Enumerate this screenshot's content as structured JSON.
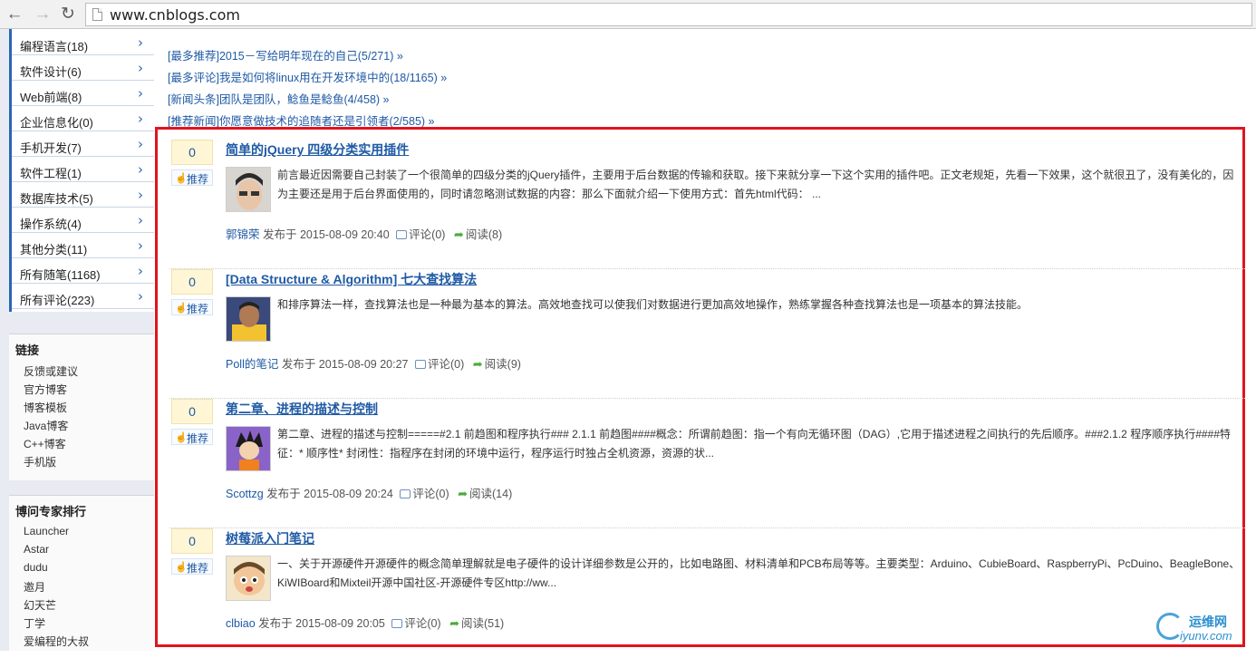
{
  "browser": {
    "url": "www.cnblogs.com"
  },
  "sidebar": {
    "categories": [
      {
        "label": "编程语言(18)"
      },
      {
        "label": "软件设计(6)"
      },
      {
        "label": "Web前端(8)"
      },
      {
        "label": "企业信息化(0)"
      },
      {
        "label": "手机开发(7)"
      },
      {
        "label": "软件工程(1)"
      },
      {
        "label": "数据库技术(5)"
      },
      {
        "label": "操作系统(4)"
      },
      {
        "label": "其他分类(11)"
      },
      {
        "label": "所有随笔(1168)"
      },
      {
        "label": "所有评论(223)"
      }
    ],
    "links": {
      "title": "链接",
      "items": [
        "反馈或建议",
        "官方博客",
        "博客模板",
        "Java博客",
        "C++博客",
        "手机版"
      ]
    },
    "experts": {
      "title": "博问专家排行",
      "items": [
        "Launcher",
        "Astar",
        "dudu",
        "邀月",
        "幻天芒",
        "丁学",
        "爱编程的大叔"
      ]
    }
  },
  "recommend": [
    "[最多推荐]2015－写给明年现在的自己(5/271) »",
    "[最多评论]我是如何将linux用在开发环境中的(18/1165) »",
    "[新闻头条]团队是团队，鲶鱼是鲶鱼(4/458) »",
    "[推荐新闻]你愿意做技术的追随者还是引领者(2/585) »"
  ],
  "posts": [
    {
      "digg": "0",
      "digg_label": "推荐",
      "title": "简单的jQuery 四级分类实用插件",
      "summary": "前言最近因需要自己封装了一个很简单的四级分类的jQuery插件，主要用于后台数据的传输和获取。接下来就分享一下这个实用的插件吧。正文老规矩，先看一下效果，这个就很丑了，没有美化的，因为主要还是用于后台界面使用的，同时请忽略测试数据的内容：那么下面就介绍一下使用方式：首先html代码： ...",
      "author": "郭锦荣",
      "published": "发布于 2015-08-09 20:40",
      "comments": "评论(0)",
      "views": "阅读(8)"
    },
    {
      "digg": "0",
      "digg_label": "推荐",
      "title": "[Data Structure & Algorithm] 七大查找算法",
      "summary": "和排序算法一样，查找算法也是一种最为基本的算法。高效地查找可以使我们对数据进行更加高效地操作，熟练掌握各种查找算法也是一项基本的算法技能。",
      "author": "Poll的笔记",
      "published": "发布于 2015-08-09 20:27",
      "comments": "评论(0)",
      "views": "阅读(9)"
    },
    {
      "digg": "0",
      "digg_label": "推荐",
      "title": "第二章、进程的描述与控制",
      "summary": "第二章、进程的描述与控制=====#2.1 前趋图和程序执行### 2.1.1 前趋图####概念：所谓前趋图：指一个有向无循环图（DAG）,它用于描述进程之间执行的先后顺序。###2.1.2 程序顺序执行####特征：* 顺序性* 封闭性：指程序在封闭的环境中运行，程序运行时独占全机资源，资源的状...",
      "author": "Scottzg",
      "published": "发布于 2015-08-09 20:24",
      "comments": "评论(0)",
      "views": "阅读(14)"
    },
    {
      "digg": "0",
      "digg_label": "推荐",
      "title": "树莓派入门笔记",
      "summary": "一、关于开源硬件开源硬件的概念简单理解就是电子硬件的设计详细参数是公开的，比如电路图、材料清单和PCB布局等等。主要类型：Arduino、CubieBoard、RaspberryPi、PcDuino、BeagleBone、KiWIBoard和Mixteil开源中国社区-开源硬件专区http://ww...",
      "author": "clbiao",
      "published": "发布于 2015-08-09 20:05",
      "comments": "评论(0)",
      "views": "阅读(51)"
    }
  ],
  "watermark": {
    "top": "运维网",
    "bottom": "iyunv.com"
  },
  "colors": {
    "accent": "#1f5aa5",
    "highlight_box": "#e0141f",
    "sidebar_bg": "#e9ebf3"
  }
}
